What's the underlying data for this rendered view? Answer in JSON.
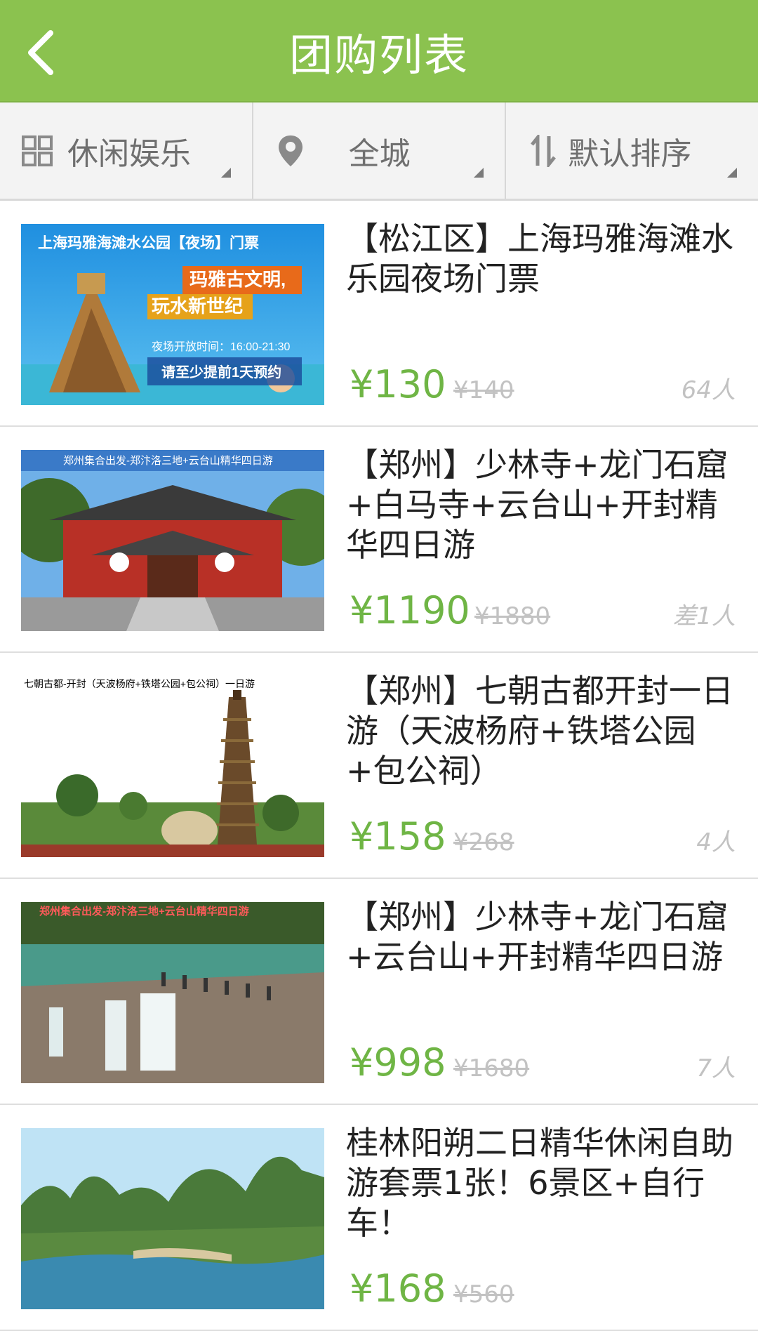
{
  "header": {
    "title": "团购列表"
  },
  "filters": [
    {
      "label": "休闲娱乐",
      "icon": "grid-icon"
    },
    {
      "label": "全城",
      "icon": "location-pin-icon"
    },
    {
      "label": "默认排序",
      "icon": "sort-icon"
    }
  ],
  "items": [
    {
      "title": "【松江区】上海玛雅海滩水乐园夜场门票",
      "price": "¥130",
      "original_price": "¥140",
      "count": "64人",
      "image_text": [
        "上海玛雅海滩水公园【夜场】门票",
        "玛雅古文明,",
        "玩水新世纪",
        "夜场开放时间：16:00-21:30",
        "请至少提前1天预约"
      ]
    },
    {
      "title": "【郑州】少林寺+龙门石窟+白马寺+云台山+开封精华四日游",
      "price": "¥1190",
      "original_price": "¥1880",
      "count": "差1人",
      "image_text": [
        "郑州集合出发-郑汴洛三地+云台山精华四日游"
      ]
    },
    {
      "title": "【郑州】七朝古都开封一日游（天波杨府+铁塔公园+包公祠）",
      "price": "¥158",
      "original_price": "¥268",
      "count": "4人",
      "image_text": [
        "七朝古都-开封（天波杨府+铁塔公园+包公祠）一日游"
      ]
    },
    {
      "title": "【郑州】少林寺+龙门石窟+云台山+开封精华四日游",
      "price": "¥998",
      "original_price": "¥1680",
      "count": "7人",
      "image_text": [
        "郑州集合出发-郑汴洛三地+云台山精华四日游"
      ]
    },
    {
      "title": "桂林阳朔二日精华休闲自助游套票1张！6景区+自行车！",
      "price": "¥168",
      "original_price": "¥560",
      "count": "",
      "image_text": []
    }
  ],
  "colors": {
    "header": "#8bc24f",
    "price": "#6fb545",
    "muted": "#c2c2c2"
  }
}
